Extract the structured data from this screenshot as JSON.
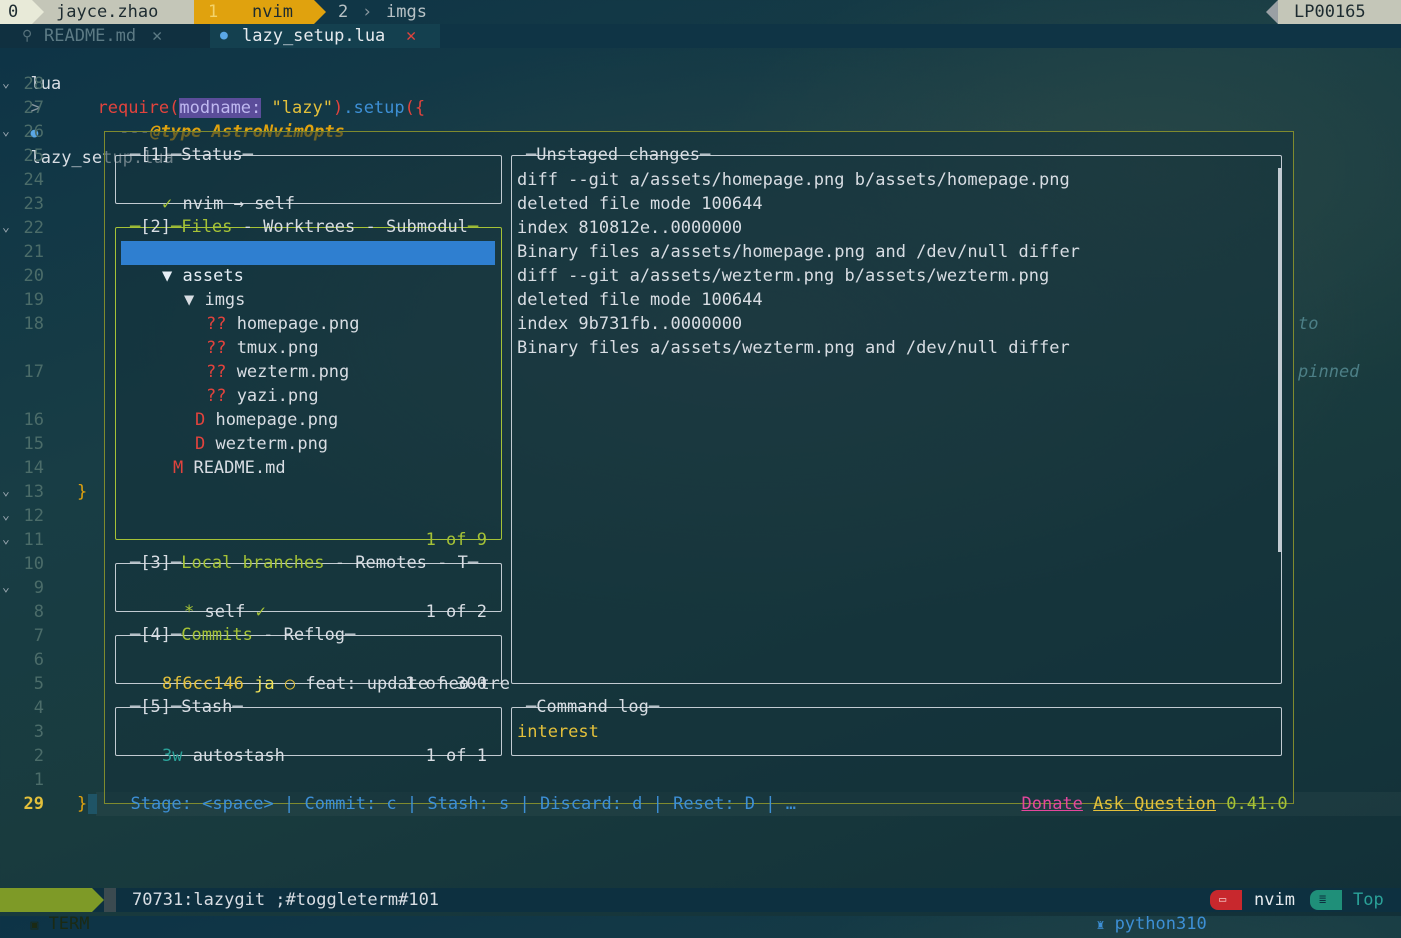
{
  "tmux": {
    "session_index": "0",
    "user": "jayce.zhao",
    "windows": [
      {
        "index": "1",
        "name": "nvim"
      },
      {
        "index": "2",
        "name": "imgs"
      }
    ],
    "host": "LP00165"
  },
  "buffer_tabs": [
    {
      "name": "README.md",
      "close": "✕",
      "icon": "pin-icon"
    },
    {
      "name": "lazy_setup.lua",
      "close": "✕",
      "icon": "lua-icon"
    }
  ],
  "breadcrumb": {
    "folder": "lua",
    "separator": ">",
    "file": "lazy_setup.lua"
  },
  "editor": {
    "line_numbers": [
      "28",
      "27",
      "26",
      "25",
      "24",
      "23",
      "22",
      "21",
      "20",
      "19",
      "18",
      "17",
      "16",
      "15",
      "14",
      "13",
      "12",
      "11",
      "10",
      "9",
      "8",
      "7",
      "6",
      "5",
      "4",
      "3",
      "2",
      "1",
      "29"
    ],
    "code": {
      "l28": {
        "fn": "require",
        "open": "(",
        "hint": "modname:",
        "str": "\"lazy\"",
        "close": ")",
        "dot": ".",
        "method": "setup",
        "brace": "({"
      },
      "l27": {
        "dashes": "---",
        "annotation": "@type",
        "type": "AstroNvimOpts"
      },
      "l13": "}",
      "l29": "}"
    },
    "virtual_text": [
      "to",
      "pinned"
    ]
  },
  "lazygit": {
    "status": {
      "num": "[1]",
      "title": "Status",
      "check": "✓",
      "text": "nvim → self"
    },
    "files": {
      "num": "[2]",
      "title": "Files",
      "sep": "-",
      "tab2": "Worktrees",
      "tab3": "Submodul",
      "count": "1 of 9",
      "items": [
        {
          "status": "▼",
          "name": "assets"
        },
        {
          "status": "▼",
          "name": "imgs"
        },
        {
          "status": "??",
          "name": "homepage.png"
        },
        {
          "status": "??",
          "name": "tmux.png"
        },
        {
          "status": "??",
          "name": "wezterm.png"
        },
        {
          "status": "??",
          "name": "yazi.png"
        },
        {
          "status": "D",
          "name": "homepage.png"
        },
        {
          "status": "D",
          "name": "wezterm.png"
        },
        {
          "status": "M",
          "name": "README.md"
        }
      ]
    },
    "branches": {
      "num": "[3]",
      "title": "Local branches",
      "tab2": "Remotes",
      "tab3": "T",
      "star": "*",
      "branch": "self",
      "check": "✓",
      "count": "1 of 2"
    },
    "commits": {
      "num": "[4]",
      "title": "Commits",
      "tab2": "Reflog",
      "hash": "8f6cc146",
      "author": "ja",
      "marker": "○",
      "msg": "feat: update neo-tre",
      "count": "1 of 300"
    },
    "stash": {
      "num": "[5]",
      "title": "Stash",
      "age": "3w",
      "name": "autostash",
      "count": "1 of 1"
    },
    "unstaged": {
      "title": "Unstaged changes",
      "lines": [
        "diff --git a/assets/homepage.png b/assets/homepage.png",
        "deleted file mode 100644",
        "index 810812e..0000000",
        "Binary files a/assets/homepage.png and /dev/null differ",
        "diff --git a/assets/wezterm.png b/assets/wezterm.png",
        "deleted file mode 100644",
        "index 9b731fb..0000000",
        "Binary files a/assets/wezterm.png and /dev/null differ"
      ]
    },
    "command_log": {
      "title": "Command log",
      "text": "interest"
    },
    "keybar": {
      "hints": [
        {
          "label": "Stage: <space>"
        },
        {
          "label": "Commit: c"
        },
        {
          "label": "Stash: s"
        },
        {
          "label": "Discard: d"
        },
        {
          "label": "Reset: D"
        },
        {
          "label": "…"
        }
      ],
      "sep": "|",
      "donate": "Donate",
      "ask": "Ask Question",
      "version": "0.41.0"
    }
  },
  "statusline": {
    "mode": "TERM",
    "term": "70731:lazygit ;#toggleterm#101",
    "python": "python310",
    "app": "nvim",
    "position": "Top"
  },
  "colors": {
    "accent_green": "#a5c236",
    "accent_yellow": "#e3c03b",
    "selection": "#2f7fd0",
    "danger": "#e2433d"
  }
}
